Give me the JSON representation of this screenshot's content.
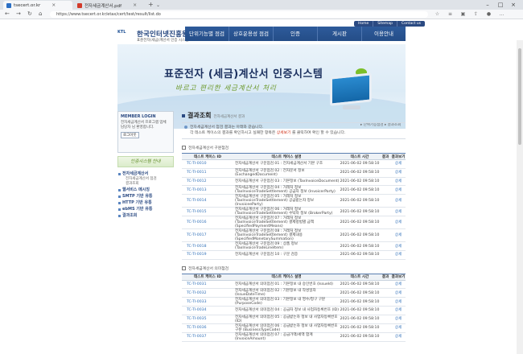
{
  "browser": {
    "tabs": [
      {
        "label": "tsecert.or.kr",
        "active": true
      },
      {
        "label": "전자세금계산서.pdf",
        "active": false
      }
    ],
    "url": "https://www.tsecert.or.kr/etax/cert/test/result/list.do"
  },
  "header": {
    "top_links": [
      "Home",
      "Sitemap",
      "Contact us"
    ],
    "logo_mark": "KTL",
    "logo_name": "한국인터넷진흥원",
    "logo_sub": "표준전자(세금)계산서 인증 시스템",
    "nav": [
      "단위기능별 점검",
      "상호운용성 점검",
      "인증",
      "게시판",
      "이용안내"
    ]
  },
  "hero": {
    "title": "표준전자 (세금)계산서 인증시스템",
    "slogan": "바르고 편리한 세금계산서 처리",
    "breadcrumb": "▸ 단위기능점검 ▸ 결과조회"
  },
  "sidebar": {
    "login_title": "MEMBER LOGIN",
    "login_msg": "전자세금계산서 프로그램 업체 담당자 님 환영합니다.",
    "login_button": "로그아웃",
    "cert_banner": "인증시스템 안내",
    "menu": [
      {
        "label": "전자세금계산서",
        "subs": [
          "전자세금계산서 점검",
          "결과조회"
        ]
      },
      {
        "label": "웹서비스 메시징",
        "subs": []
      },
      {
        "label": "SMTP 기반 유통",
        "subs": []
      },
      {
        "label": "HTTP 기반 유통",
        "subs": []
      },
      {
        "label": "ebMS 기반 유통",
        "subs": []
      },
      {
        "label": "결과조회",
        "subs": []
      }
    ]
  },
  "main": {
    "title": "결과조회",
    "subtitle": "전자세금계산서 결과",
    "notice_line1": "전자세금계산서 점검 결과는 아래와 같습니다.",
    "notice_line2_pre": "각 테스트 케이스의 결과를 확인하시고 실패한 항목은 ",
    "notice_line2_em": "상세보기",
    "notice_line2_post": " 를 클릭하여 확인 할 수 있습니다.",
    "section1": "전자세금계산서 구문점검",
    "section2": "전자세금계산서 의미점검",
    "columns": [
      "테스트 케이스 ID",
      "테스트 케이스 설명",
      "테스트 시간",
      "결과",
      "결과보기"
    ],
    "rows1": [
      {
        "id": "TC-TI-0010",
        "desc": "전자세금계산서 구문점검 01 : 전자세금계산서 기본 구조",
        "time": "2021-06-02 09:58:10",
        "result": "",
        "view": "상세"
      },
      {
        "id": "TC-TI-0011",
        "desc": "전자세금계산서 구문점검 02 : 전자문서 정보 (ExchangedDocument)",
        "time": "2021-06-02 09:58:10",
        "result": "",
        "view": "상세"
      },
      {
        "id": "TC-TI-0012",
        "desc": "전자세금계산서 구문점검 03 : 기본정보 (TaxInvoiceDocument)",
        "time": "2021-06-02 09:58:10",
        "result": "",
        "view": "상세"
      },
      {
        "id": "TC-TI-0013",
        "desc": "전자세금계산서 구문점검 04 : 거래처 정보 (TaxInvoiceTradeSettlement) 공급자 정보 (InvoicerParty)",
        "time": "2021-06-02 09:58:10",
        "result": "",
        "view": "상세"
      },
      {
        "id": "TC-TI-0014",
        "desc": "전자세금계산서 구문점검 05 : 거래처 정보 (TaxInvoiceTradeSettlement) 공급받는자 정보 (InvoiceeParty)",
        "time": "2021-06-02 09:58:10",
        "result": "",
        "view": "상세"
      },
      {
        "id": "TC-TI-0015",
        "desc": "전자세금계산서 구문점검 06 : 거래처 정보 (TaxInvoiceTradeSettlement) 수탁자 정보 (BrokerParty)",
        "time": "2021-06-02 09:58:10",
        "result": "",
        "view": "상세"
      },
      {
        "id": "TC-TI-0016",
        "desc": "전자세금계산서 구문점검 07 : 거래처 정보 (TaxInvoiceTradeSettlement) 결제방법별 금액 (SpecifiedPaymentMeans)",
        "time": "2021-06-02 09:58:10",
        "result": "",
        "view": "상세"
      },
      {
        "id": "TC-TI-0017",
        "desc": "전자세금계산서 구문점검 08 : 거래처 정보 (TaxInvoiceTradeSettlement) 결제내용 (SpecifiedMonetarySummation)",
        "time": "2021-06-02 09:58:10",
        "result": "",
        "view": "상세"
      },
      {
        "id": "TC-TI-0018",
        "desc": "전자세금계산서 구문점검 09 : 상품 정보 (TaxInvoiceTradeLineItem)",
        "time": "2021-06-02 09:58:10",
        "result": "",
        "view": "상세"
      },
      {
        "id": "TC-TI-0019",
        "desc": "전자세금계산서 구문점검 10 : 구문 검증",
        "time": "2021-06-02 09:58:10",
        "result": "",
        "view": "상세"
      }
    ],
    "rows2": [
      {
        "id": "TC-TI-0031",
        "desc": "전자세금계산서 의미점검 01 : 기본정보 내 승인번호 (IssueId)",
        "time": "2021-06-02 09:58:10",
        "result": "",
        "view": "상세"
      },
      {
        "id": "TC-TI-0032",
        "desc": "전자세금계산서 의미점검 02 : 기본정보 내 작성일자 (IssueDateTime)",
        "time": "2021-06-02 09:58:10",
        "result": "",
        "view": "상세"
      },
      {
        "id": "TC-TI-0033",
        "desc": "전자세금계산서 의미점검 03 : 기본정보 내 영수/청구 구분 (PurposeCode)",
        "time": "2021-06-02 09:58:10",
        "result": "",
        "view": "상세"
      },
      {
        "id": "TC-TI-0034",
        "desc": "전자세금계산서 의미점검 04 : 공급자 정보 내 사업자등록번호 (ID)",
        "time": "2021-06-02 09:58:10",
        "result": "",
        "view": "상세"
      },
      {
        "id": "TC-TI-0035",
        "desc": "전자세금계산서 의미점검 05 : 공급받는자 정보 내 사업자등록번호 (ID)",
        "time": "2021-06-02 09:58:10",
        "result": "",
        "view": "상세"
      },
      {
        "id": "TC-TI-0036",
        "desc": "전자세금계산서 의미점검 06 : 공급받는자 정보 내 사업자등록번호 구분 (BusinessTypeCode)",
        "time": "2021-06-02 09:58:10",
        "result": "",
        "view": "상세"
      },
      {
        "id": "TC-TI-0037",
        "desc": "전자세금계산서 의미점검 07 : 공급가액/세액 합계 (InvoiceAmount)",
        "time": "2021-06-02 09:58:10",
        "result": "",
        "view": "상세"
      }
    ]
  }
}
